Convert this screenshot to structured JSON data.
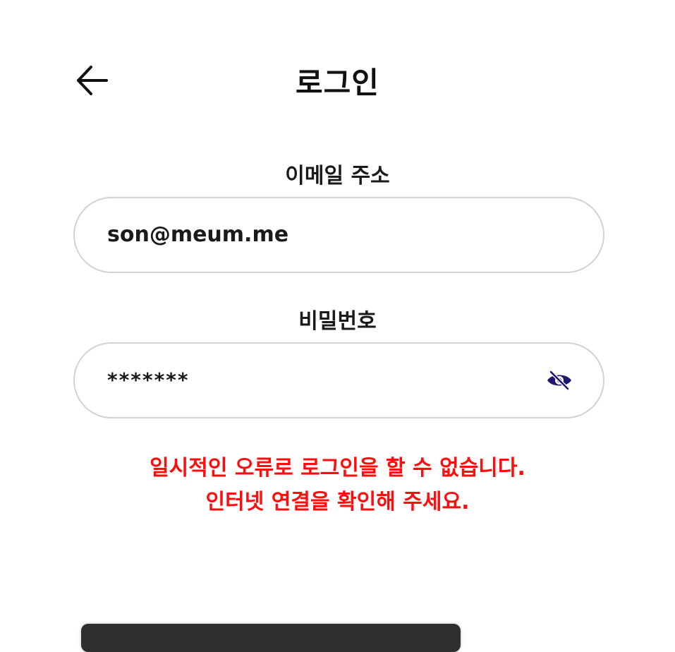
{
  "header": {
    "title": "로그인",
    "back_icon": "arrow-left-icon"
  },
  "form": {
    "email": {
      "label": "이메일 주소",
      "value": "son@meum.me"
    },
    "password": {
      "label": "비밀번호",
      "value": "*******",
      "toggle_icon": "eye-off-icon",
      "toggle_color": "#1f1670"
    },
    "error": {
      "line1": "일시적인 오류로 로그인을 할 수 없습니다.",
      "line2": "인터넷 연결을 확인해 주세요.",
      "color": "#ff0d0d"
    }
  },
  "colors": {
    "background": "#ffffff",
    "field_border": "#d2d2d2",
    "bottom_button": "#2f2f2f"
  }
}
